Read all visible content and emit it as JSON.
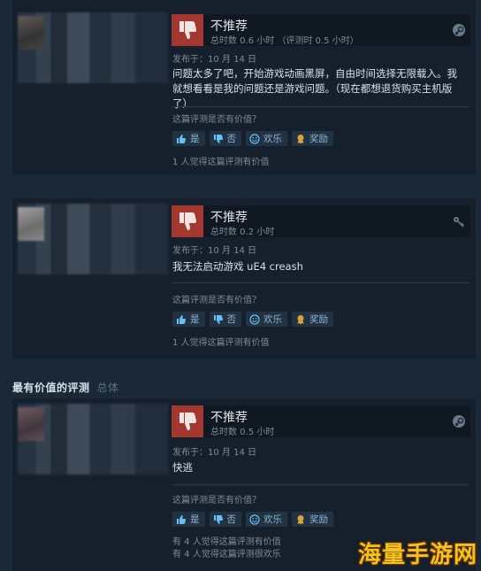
{
  "reviews": [
    {
      "verdict": "不推荐",
      "hours": "总时数 0.6 小时 （评测时 0.5 小时）",
      "posted": "发布于：10 月 14 日",
      "content": "问题太多了吧，开始游戏动画黑屏，自由时间选择无限载入。我就想看看是我的问题还是游戏问题。（现在都想退货购买主机版了）",
      "helpful_question": "这篇评测是否有价值？",
      "buttons": {
        "yes": "是",
        "no": "否",
        "funny": "欢乐",
        "award": "奖励"
      },
      "helpful_count": "1 人觉得这篇评测有价值",
      "funny_count": ""
    },
    {
      "verdict": "不推荐",
      "hours": "总时数 0.2 小时",
      "posted": "发布于：10 月 14 日",
      "content": "我无法启动游戏 uE4 creash",
      "helpful_question": "这篇评测是否有价值？",
      "buttons": {
        "yes": "是",
        "no": "否",
        "funny": "欢乐",
        "award": "奖励"
      },
      "helpful_count": "1 人觉得这篇评测有价值",
      "funny_count": ""
    },
    {
      "verdict": "不推荐",
      "hours": "总时数 0.5 小时",
      "posted": "发布于：10 月 14 日",
      "content": "快逃",
      "helpful_question": "这篇评测是否有价值？",
      "buttons": {
        "yes": "是",
        "no": "否",
        "funny": "欢乐",
        "award": "奖励"
      },
      "helpful_count": "有 4 人觉得这篇评测有价值",
      "funny_count": "有 4 人觉得这篇评测很欢乐"
    }
  ],
  "section": {
    "title": "最有价值的评测",
    "tab_overall": "总体"
  },
  "watermark": "海量手游网",
  "colors": {
    "thumb_down_bg": "#a33831",
    "link_blue": "#66c0f4",
    "page_bg": "#1b2838"
  }
}
